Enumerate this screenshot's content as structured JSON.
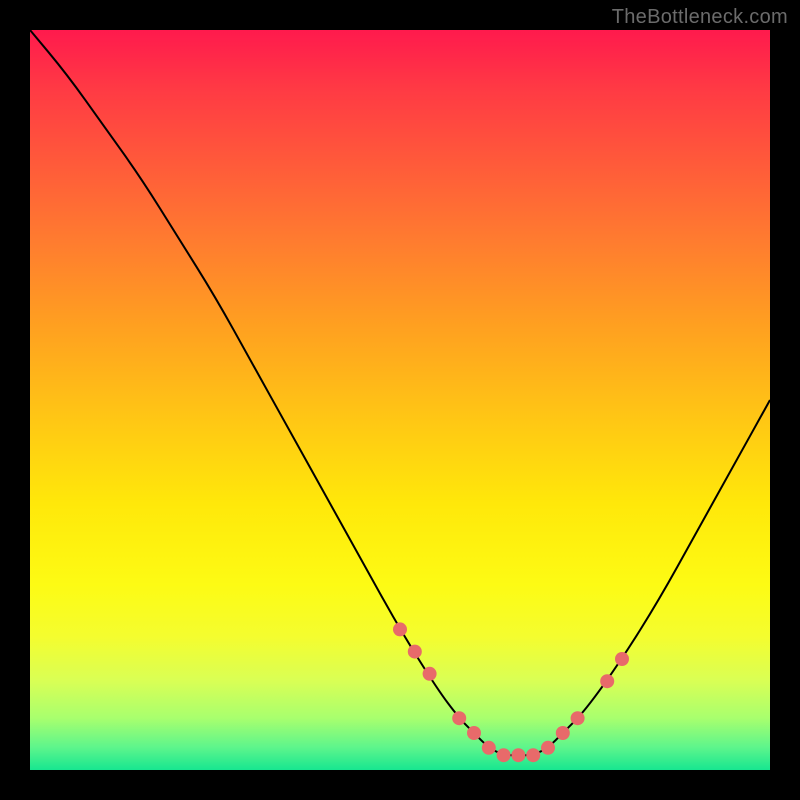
{
  "watermark": "TheBottleneck.com",
  "chart_data": {
    "type": "line",
    "title": "",
    "xlabel": "",
    "ylabel": "",
    "xlim": [
      0,
      100
    ],
    "ylim": [
      0,
      100
    ],
    "series": [
      {
        "name": "curve",
        "x": [
          0,
          5,
          10,
          15,
          20,
          25,
          30,
          35,
          40,
          45,
          50,
          55,
          58,
          60,
          62,
          64,
          66,
          68,
          70,
          72,
          75,
          80,
          85,
          90,
          95,
          100
        ],
        "values": [
          100,
          94,
          87,
          80,
          72,
          64,
          55,
          46,
          37,
          28,
          19,
          11,
          7,
          5,
          3,
          2,
          2,
          2,
          3,
          5,
          8,
          15,
          23,
          32,
          41,
          50
        ]
      }
    ],
    "markers": {
      "name": "highlight-points",
      "x": [
        50,
        52,
        54,
        58,
        60,
        62,
        64,
        66,
        68,
        70,
        72,
        74,
        78,
        80
      ],
      "values": [
        19,
        16,
        13,
        7,
        5,
        3,
        2,
        2,
        2,
        3,
        5,
        7,
        12,
        15
      ],
      "color": "#e86a6a",
      "radius": 7
    },
    "curve_color": "#000000",
    "curve_width": 2
  },
  "plot": {
    "inner_x": 30,
    "inner_y": 30,
    "inner_w": 740,
    "inner_h": 740
  }
}
